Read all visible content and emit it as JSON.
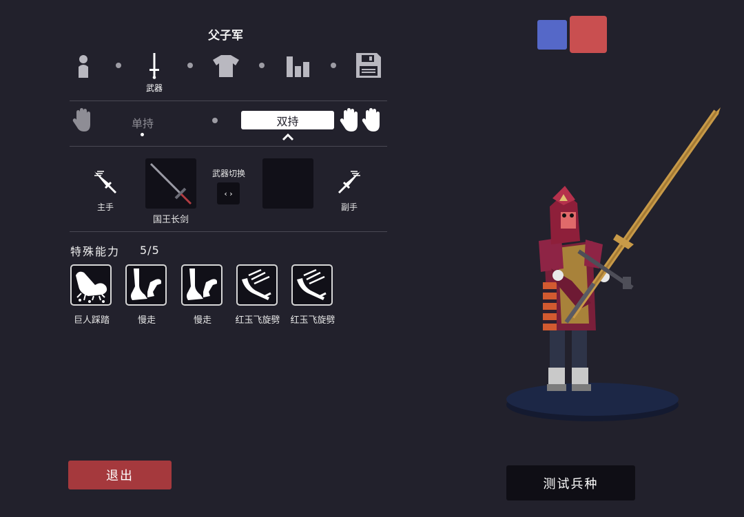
{
  "unit_name": "父子军",
  "tabs": [
    {
      "icon": "person-icon",
      "label": ""
    },
    {
      "icon": "sword-icon",
      "label": "武器"
    },
    {
      "icon": "shirt-icon",
      "label": ""
    },
    {
      "icon": "stats-icon",
      "label": ""
    },
    {
      "icon": "save-icon",
      "label": ""
    }
  ],
  "grip": {
    "one_handed_label": "单持",
    "dual_label": "双持",
    "selected": "双持"
  },
  "weapons": {
    "main_hand_label": "主手",
    "off_hand_label": "副手",
    "main_weapon_name": "国王长剑",
    "switch_label": "武器切换",
    "switch_button": "‹ ›"
  },
  "abilities": {
    "title": "特殊能力",
    "count": "5/5",
    "items": [
      {
        "label": "巨人踩踏",
        "icon": "stomp-icon"
      },
      {
        "label": "慢走",
        "icon": "slow-walk-icon"
      },
      {
        "label": "慢走",
        "icon": "slow-walk-icon"
      },
      {
        "label": "红玉飞旋劈",
        "icon": "spin-slash-icon"
      },
      {
        "label": "红玉飞旋劈",
        "icon": "spin-slash-icon"
      }
    ]
  },
  "team_colors": {
    "blue": "#5568c8",
    "red": "#c94f50"
  },
  "buttons": {
    "exit": "退出",
    "test": "测试兵种"
  },
  "colors": {
    "background": "#22212c",
    "accent_red": "#a5393d"
  }
}
